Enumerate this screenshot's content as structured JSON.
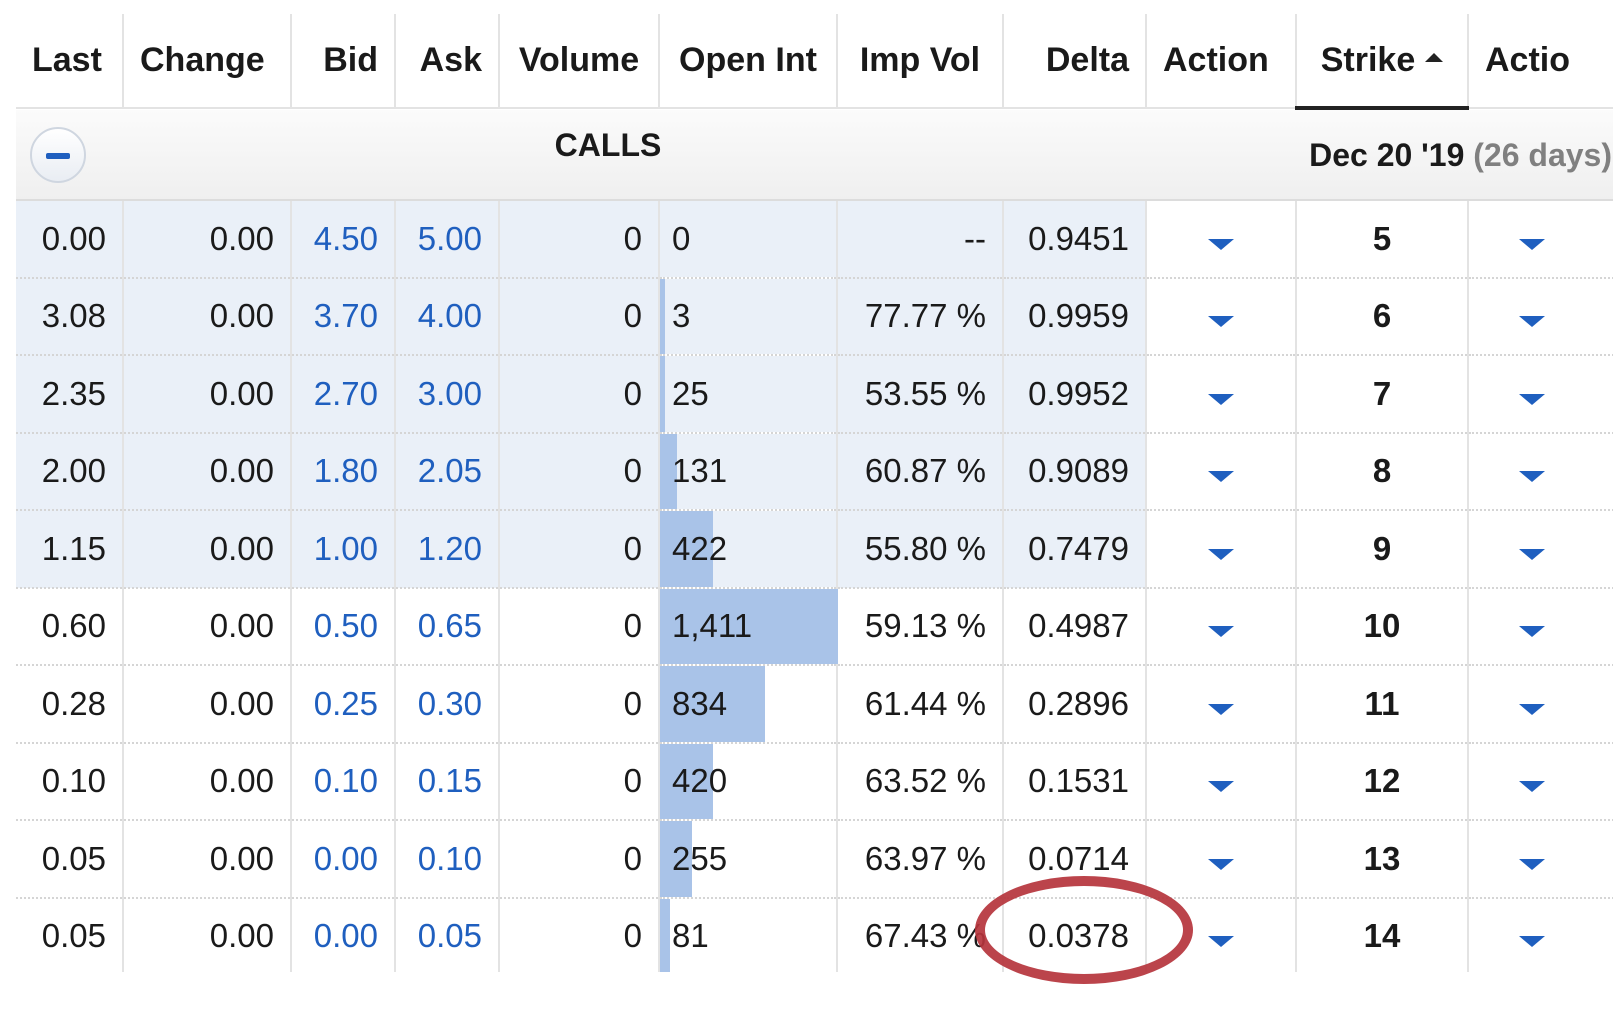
{
  "headers": {
    "last": "Last",
    "change": "Change",
    "bid": "Bid",
    "ask": "Ask",
    "volume": "Volume",
    "open_int": "Open Int",
    "imp_vol": "Imp Vol",
    "delta": "Delta",
    "action": "Action",
    "strike": "Strike",
    "action2": "Actio"
  },
  "sort": {
    "column": "Strike",
    "direction": "ascending"
  },
  "group": {
    "label": "CALLS",
    "expiration": "Dec 20 '19",
    "days": "(26 days)",
    "collapse_icon": "minus-icon"
  },
  "colors": {
    "price_blue": "#1f5fbf",
    "itm_background": "#eaf0f8",
    "open_interest_bar": "#a9c3e8",
    "annotation_circle": "#b5343c"
  },
  "open_interest_max": 1411,
  "rows": [
    {
      "last": "0.00",
      "change": "0.00",
      "bid": "4.50",
      "ask": "5.00",
      "volume": "0",
      "open_int": "0",
      "open_int_value": 0,
      "imp_vol": "--",
      "delta": "0.9451",
      "strike": "5",
      "itm": true
    },
    {
      "last": "3.08",
      "change": "0.00",
      "bid": "3.70",
      "ask": "4.00",
      "volume": "0",
      "open_int": "3",
      "open_int_value": 3,
      "imp_vol": "77.77 %",
      "delta": "0.9959",
      "strike": "6",
      "itm": true
    },
    {
      "last": "2.35",
      "change": "0.00",
      "bid": "2.70",
      "ask": "3.00",
      "volume": "0",
      "open_int": "25",
      "open_int_value": 25,
      "imp_vol": "53.55 %",
      "delta": "0.9952",
      "strike": "7",
      "itm": true
    },
    {
      "last": "2.00",
      "change": "0.00",
      "bid": "1.80",
      "ask": "2.05",
      "volume": "0",
      "open_int": "131",
      "open_int_value": 131,
      "imp_vol": "60.87 %",
      "delta": "0.9089",
      "strike": "8",
      "itm": true
    },
    {
      "last": "1.15",
      "change": "0.00",
      "bid": "1.00",
      "ask": "1.20",
      "volume": "0",
      "open_int": "422",
      "open_int_value": 422,
      "imp_vol": "55.80 %",
      "delta": "0.7479",
      "strike": "9",
      "itm": true
    },
    {
      "last": "0.60",
      "change": "0.00",
      "bid": "0.50",
      "ask": "0.65",
      "volume": "0",
      "open_int": "1,411",
      "open_int_value": 1411,
      "imp_vol": "59.13 %",
      "delta": "0.4987",
      "strike": "10",
      "itm": false
    },
    {
      "last": "0.28",
      "change": "0.00",
      "bid": "0.25",
      "ask": "0.30",
      "volume": "0",
      "open_int": "834",
      "open_int_value": 834,
      "imp_vol": "61.44 %",
      "delta": "0.2896",
      "strike": "11",
      "itm": false
    },
    {
      "last": "0.10",
      "change": "0.00",
      "bid": "0.10",
      "ask": "0.15",
      "volume": "0",
      "open_int": "420",
      "open_int_value": 420,
      "imp_vol": "63.52 %",
      "delta": "0.1531",
      "strike": "12",
      "itm": false
    },
    {
      "last": "0.05",
      "change": "0.00",
      "bid": "0.00",
      "ask": "0.10",
      "volume": "0",
      "open_int": "255",
      "open_int_value": 255,
      "imp_vol": "63.97 %",
      "delta": "0.0714",
      "strike": "13",
      "itm": false
    },
    {
      "last": "0.05",
      "change": "0.00",
      "bid": "0.00",
      "ask": "0.05",
      "volume": "0",
      "open_int": "81",
      "open_int_value": 81,
      "imp_vol": "67.43 %",
      "delta": "0.0378",
      "strike": "14",
      "itm": false,
      "highlighted_cell": "delta"
    }
  ]
}
